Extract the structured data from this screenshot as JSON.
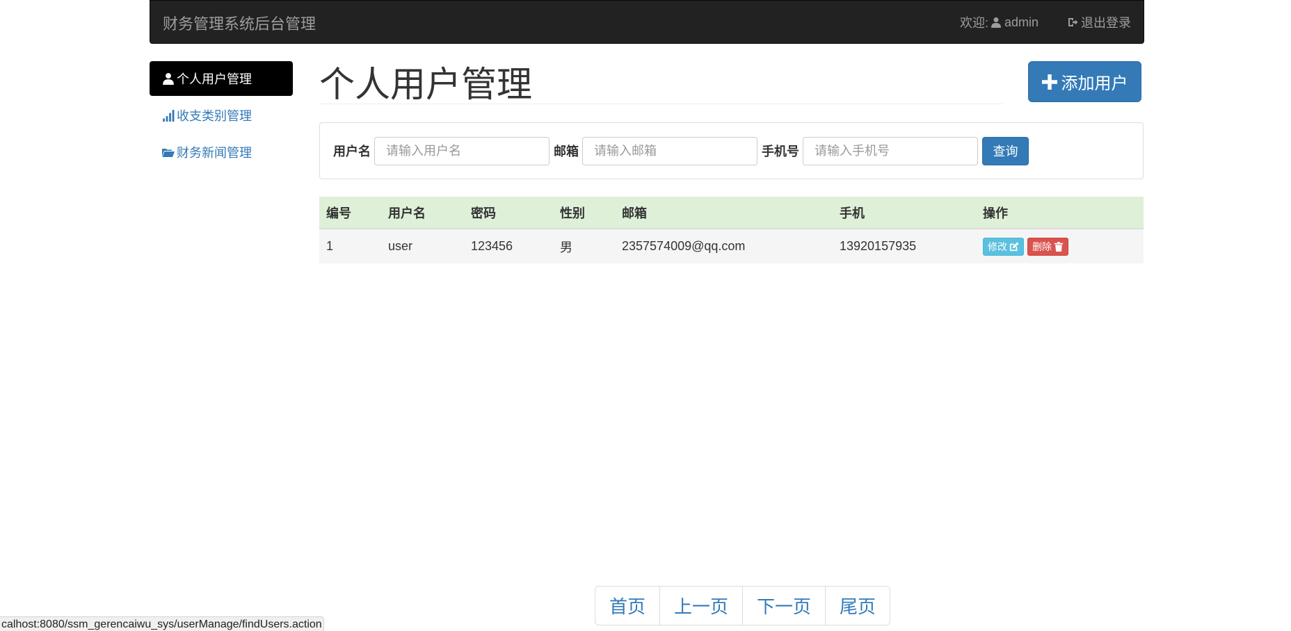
{
  "navbar": {
    "brand": "财务管理系统后台管理",
    "welcome_label": "欢迎:",
    "user_icon": "user-icon",
    "username": "admin",
    "logout_icon": "log-out-icon",
    "logout_label": "退出登录"
  },
  "sidebar": {
    "items": [
      {
        "icon": "user-icon",
        "label": "个人用户管理",
        "active": true
      },
      {
        "icon": "signal-icon",
        "label": "收支类别管理",
        "active": false
      },
      {
        "icon": "folder-open-icon",
        "label": "财务新闻管理",
        "active": false
      }
    ]
  },
  "page": {
    "title": "个人用户管理",
    "add_button_icon": "plus-icon",
    "add_button_label": "添加用户"
  },
  "search": {
    "username_label": "用户名",
    "username_placeholder": "请输入用户名",
    "email_label": "邮箱",
    "email_placeholder": "请输入邮箱",
    "phone_label": "手机号",
    "phone_placeholder": "请输入手机号",
    "submit_label": "查询"
  },
  "table": {
    "headers": [
      "编号",
      "用户名",
      "密码",
      "性别",
      "邮箱",
      "手机",
      "操作"
    ],
    "rows": [
      {
        "id": "1",
        "username": "user",
        "password": "123456",
        "gender": "男",
        "email": "2357574009@qq.com",
        "phone": "13920157935",
        "edit_label": "修改",
        "delete_label": "删除"
      }
    ]
  },
  "pagination": {
    "first": "首页",
    "prev": "上一页",
    "next": "下一页",
    "last": "尾页"
  },
  "status_bar": {
    "url": "calhost:8080/ssm_gerencaiwu_sys/userManage/findUsers.action"
  },
  "colors": {
    "navbar_bg": "#222222",
    "primary": "#337ab7",
    "info": "#5bc0de",
    "danger": "#d9534f",
    "table_header_bg": "#dff0d8",
    "table_row_bg": "#f5f5f5"
  }
}
